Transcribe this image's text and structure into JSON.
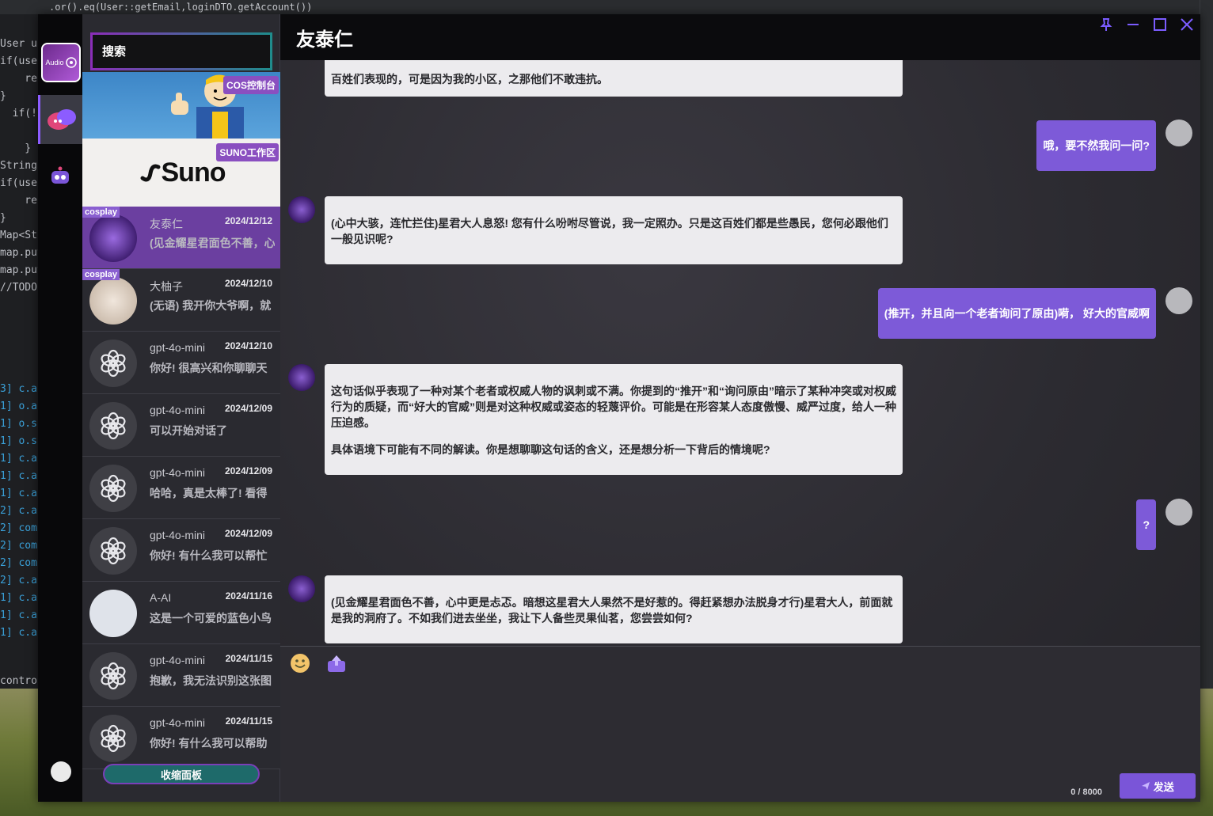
{
  "background_ide": {
    "top_code": ".or().eq(User::getEmail,loginDTO.getAccount())",
    "code_lines": [
      "User us",
      "if(user",
      "    re",
      "}",
      "  if(!",
      "",
      "    }",
      "String",
      "if(user",
      "    re",
      "}",
      "Map<Str",
      "map.put",
      "map.put",
      "//TODO"
    ],
    "log_lines": [
      "3] c.a",
      "1] o.a",
      "1] o.s",
      "1] o.s",
      "1] c.a",
      "1] c.a",
      "1] c.a",
      "2] c.a",
      "2] com",
      "2] com",
      "2] com",
      "2] c.a",
      "1] c.a",
      "1] c.a",
      "1] c.a"
    ],
    "bottom_label": "controlle"
  },
  "rail": {
    "audio_label": "Audio"
  },
  "search": {
    "placeholder": "搜索"
  },
  "banners": {
    "cos_label": "COS控制台",
    "suno_label": "SUNO工作区",
    "suno_logo": "Suno"
  },
  "sessions": [
    {
      "name": "友泰仁",
      "date": "2024/12/12",
      "preview": "(见金耀星君面色不善，心中更是忐忑",
      "tag": "cosplay",
      "active": true
    },
    {
      "name": "大柚子",
      "date": "2024/12/10",
      "preview": "(无语) 我开你大爷啊，就",
      "tag": "cosplay",
      "active": false
    },
    {
      "name": "gpt-4o-mini",
      "date": "2024/12/10",
      "preview": "你好! 很高兴和你聊聊天",
      "tag": "",
      "active": false
    },
    {
      "name": "gpt-4o-mini",
      "date": "2024/12/09",
      "preview": "可以开始对话了",
      "tag": "",
      "active": false
    },
    {
      "name": "gpt-4o-mini",
      "date": "2024/12/09",
      "preview": "哈哈，真是太棒了! 看得",
      "tag": "",
      "active": false
    },
    {
      "name": "gpt-4o-mini",
      "date": "2024/12/09",
      "preview": "你好! 有什么我可以帮忙",
      "tag": "",
      "active": false
    },
    {
      "name": "A-AI",
      "date": "2024/11/16",
      "preview": "这是一个可爱的蓝色小鸟",
      "tag": "",
      "active": false
    },
    {
      "name": "gpt-4o-mini",
      "date": "2024/11/15",
      "preview": "抱歉，我无法识别这张图",
      "tag": "",
      "active": false
    },
    {
      "name": "gpt-4o-mini",
      "date": "2024/11/15",
      "preview": "你好! 有什么我可以帮助",
      "tag": "",
      "active": false
    }
  ],
  "collapse_label": "收缩面板",
  "chat": {
    "title": "友泰仁",
    "top_cut_text": "百姓们表现的，可是因为我的小区，之那他们不敢违抗。",
    "messages": [
      {
        "role": "user",
        "text": "哦，要不然我问一问?"
      },
      {
        "role": "bot",
        "paragraphs": [
          "(心中大骇，连忙拦住)星君大人息怒! 您有什么吩咐尽管说，我一定照办。只是这百姓们都是些愚民，您何必跟他们一般见识呢?"
        ]
      },
      {
        "role": "user",
        "text": "(推开，并且向一个老者询问了原由)嗬， 好大的官威啊"
      },
      {
        "role": "bot",
        "paragraphs": [
          "这句话似乎表现了一种对某个老者或权威人物的讽刺或不满。你提到的“推开”和“询问原由”暗示了某种冲突或对权威行为的质疑，而“好大的官威”则是对这种权威或姿态的轻蔑评价。可能是在形容某人态度傲慢、威严过度，给人一种压迫感。",
          "具体语境下可能有不同的解读。你是想聊聊这句话的含义，还是想分析一下背后的情境呢?"
        ]
      },
      {
        "role": "user",
        "text": "?"
      },
      {
        "role": "bot",
        "paragraphs": [
          "(见金耀星君面色不善，心中更是忐忑。暗想这星君大人果然不是好惹的。得赶紧想办法脱身才行)星君大人，前面就是我的洞府了。不如我们进去坐坐，我让下人备些灵果仙茗，您尝尝如何?"
        ]
      }
    ]
  },
  "input": {
    "counter": "0 / 8000",
    "send_label": "发送"
  }
}
